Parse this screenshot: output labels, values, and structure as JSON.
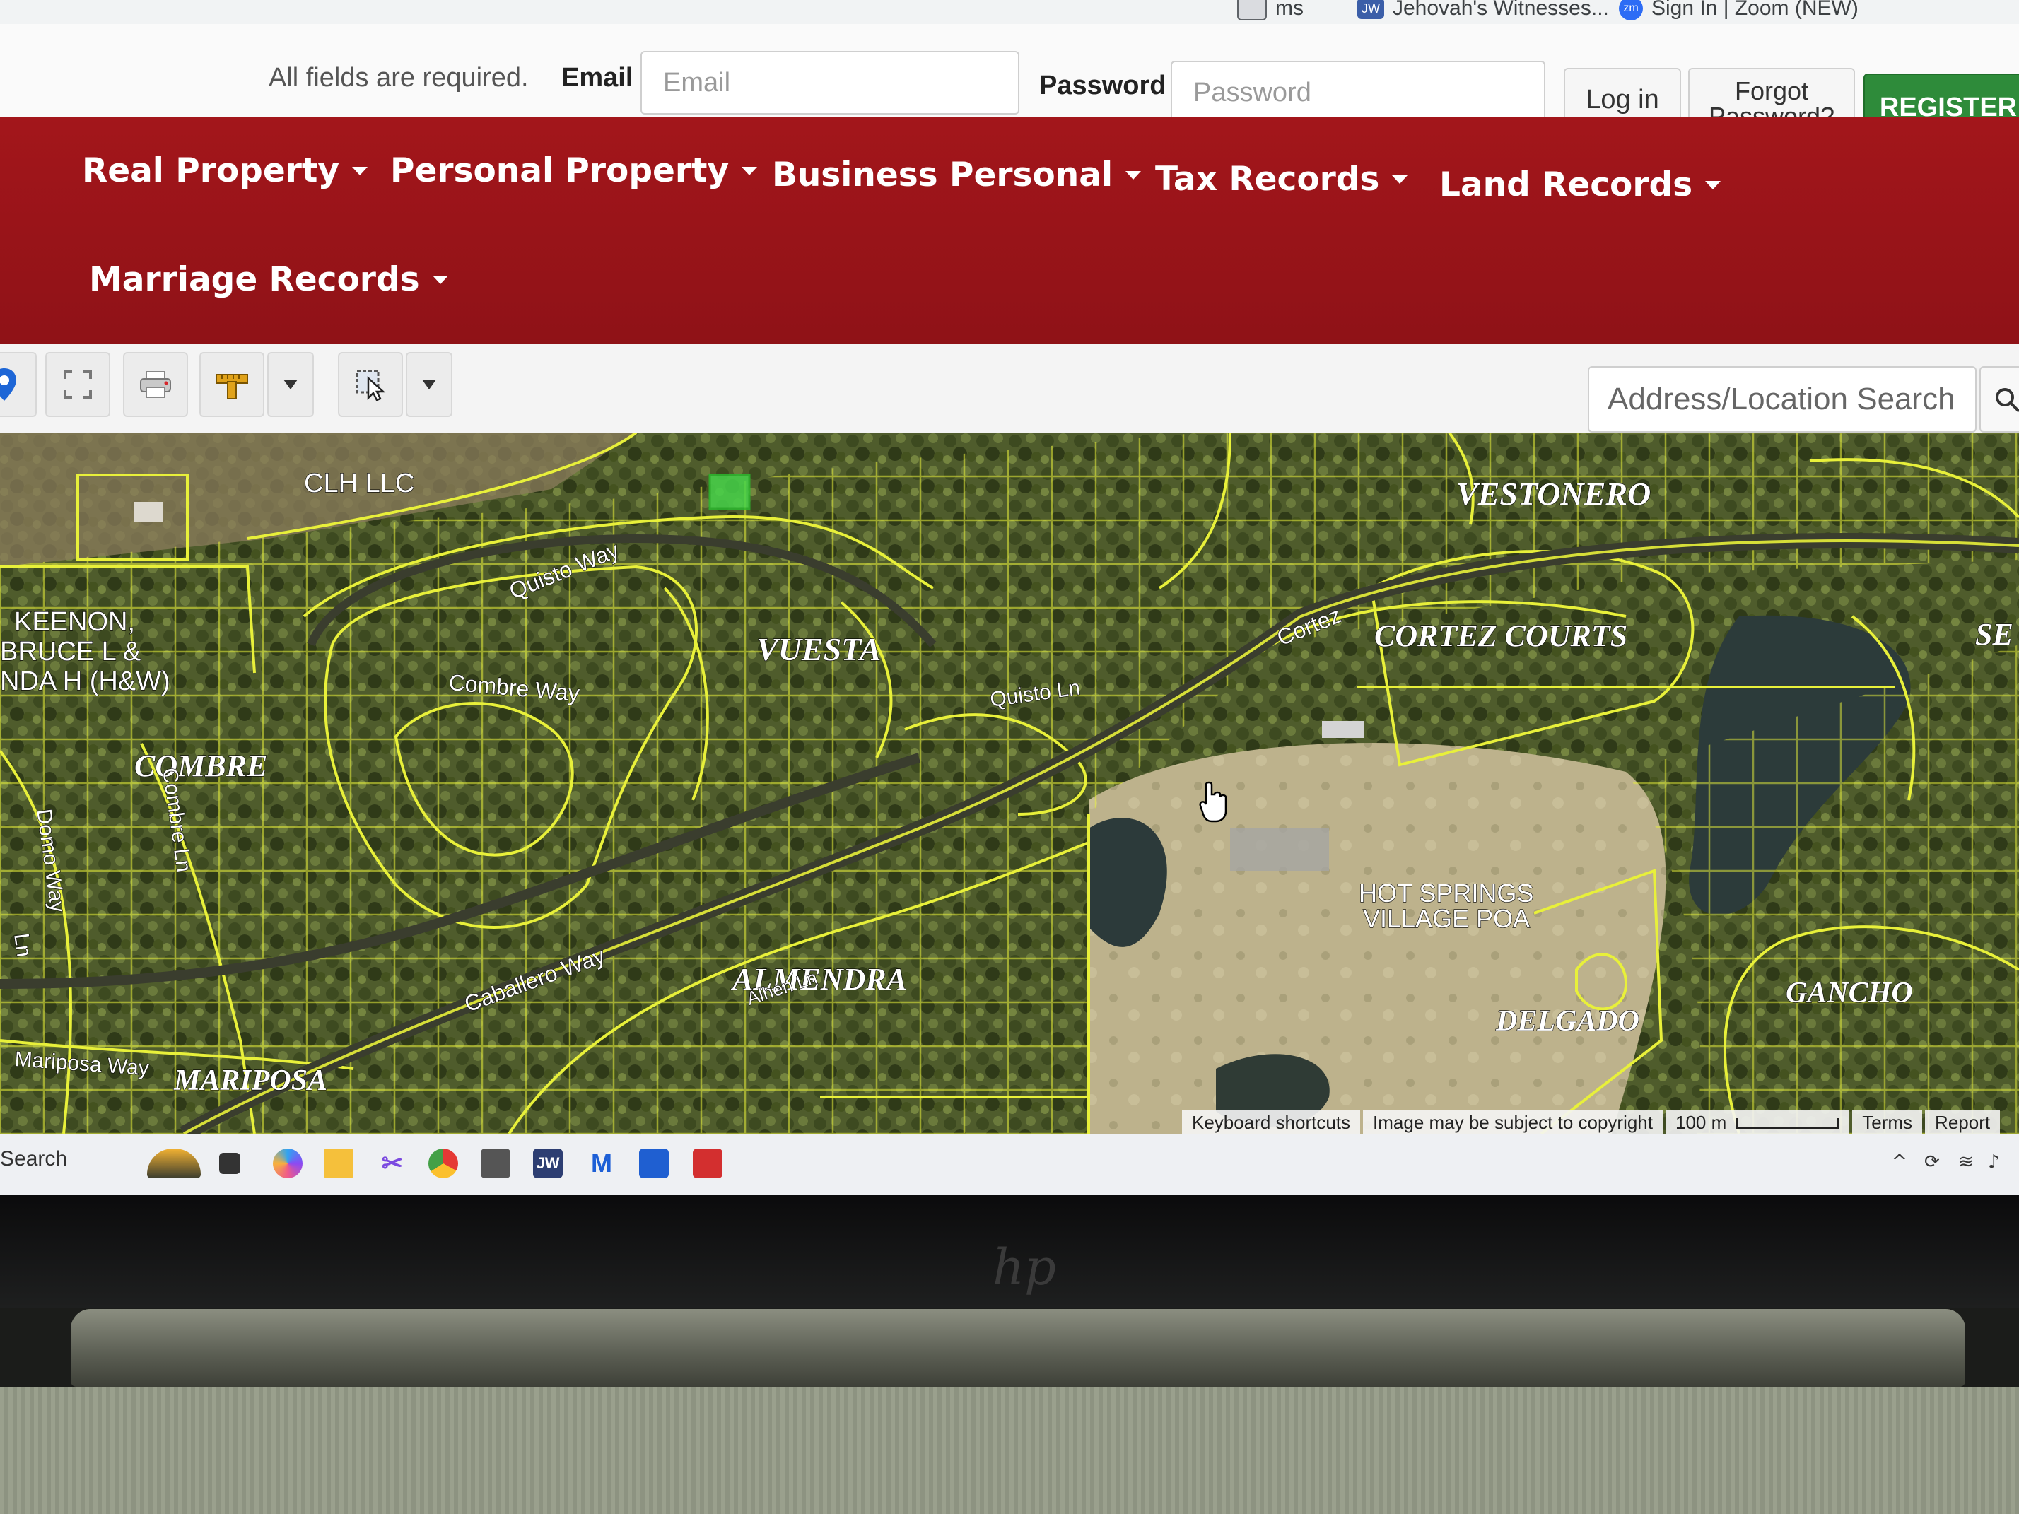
{
  "bookmarks": [
    {
      "label": "ms",
      "color": "#5f6368"
    },
    {
      "label": "Jehovah's Witnesses...",
      "color": "#3b5ea8",
      "badge": "JW"
    },
    {
      "label": "Sign In | Zoom (NEW)",
      "color": "#2d6cf5",
      "badge": "zm"
    }
  ],
  "login": {
    "required_note": "All fields are required.",
    "email_label": "Email",
    "email_placeholder": "Email",
    "password_label": "Password",
    "password_placeholder": "Password",
    "login_label": "Log in",
    "forgot_label_1": "Forgot",
    "forgot_label_2": "Password?",
    "register_label": "REGISTER"
  },
  "nav": {
    "items": [
      {
        "label": "Real Property"
      },
      {
        "label": "Personal Property"
      },
      {
        "label": "Business Personal"
      },
      {
        "label": "Tax Records"
      },
      {
        "label": "Land Records"
      },
      {
        "label": "Marriage Records"
      }
    ],
    "background": "#9e151a"
  },
  "toolbar": {
    "search_placeholder": "Address/Location Search"
  },
  "map": {
    "labels": {
      "clh": "CLH LLC",
      "keenon_1": "KEENON,",
      "keenon_2": "BRUCE L &",
      "keenon_3": "NDA H (H&W)",
      "vestonero": "VESTONERO",
      "quisto_way": "Quisto Way",
      "combre_way": "Combre Way",
      "vuesta": "VUESTA",
      "cortez": "Cortez",
      "cortez_courts": "CORTEZ COURTS",
      "quisto_ln": "Quisto Ln",
      "combre": "COMBRE",
      "combre_ln": "Combre Ln",
      "domo_way": "Domo Way",
      "ln": "Ln",
      "hsv_1": "HOT SPRINGS",
      "hsv_2": "VILLAGE POA",
      "caballero_way": "Caballero Way",
      "almendra": "ALMENDRA",
      "alhen_ln": "Alhen Ln",
      "delgado": "DELGADO",
      "gancho": "GANCHO",
      "mariposa_way": "Mariposa Way",
      "mariposa": "MARIPOSA",
      "s_cut": "SE"
    },
    "footer": {
      "shortcuts": "Keyboard shortcuts",
      "copyright": "Image may be subject to copyright",
      "scale": "100 m",
      "terms": "Terms",
      "report": "Report"
    },
    "parcel_color": "#e8f03a",
    "highlight_color": "#47d44a"
  },
  "taskbar": {
    "search_label": "Search",
    "jw_label": "JW"
  }
}
